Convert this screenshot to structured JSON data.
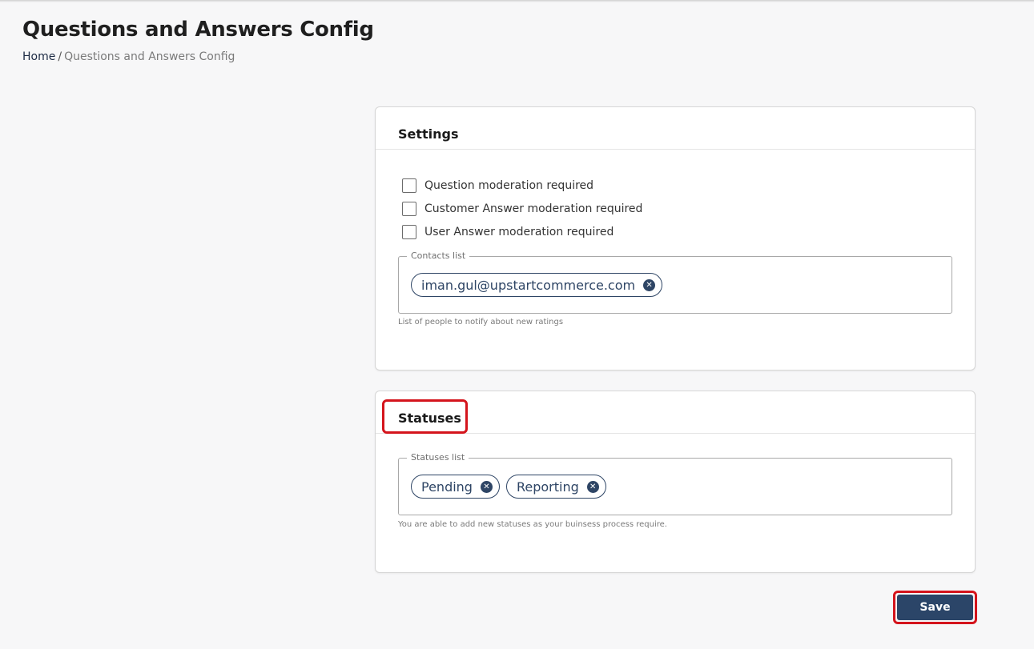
{
  "page": {
    "title": "Questions and Answers Config",
    "breadcrumb": {
      "home": "Home",
      "separator": "/",
      "current": "Questions and Answers Config"
    }
  },
  "settings": {
    "title": "Settings",
    "checkboxes": [
      {
        "label": "Question moderation required",
        "checked": false
      },
      {
        "label": "Customer Answer moderation required",
        "checked": false
      },
      {
        "label": "User Answer moderation required",
        "checked": false
      }
    ],
    "contacts": {
      "legend": "Contacts list",
      "chips": [
        "iman.gul@upstartcommerce.com"
      ],
      "helper": "List of people to notify about new ratings"
    }
  },
  "statuses": {
    "title": "Statuses",
    "list": {
      "legend": "Statuses list",
      "chips": [
        "Pending",
        "Reporting"
      ],
      "helper": "You are able to add new statuses as your buinsess process require."
    }
  },
  "actions": {
    "save_label": "Save"
  },
  "colors": {
    "primary": "#2b4568",
    "highlight": "#d4141c",
    "chip": "#2e4565"
  }
}
